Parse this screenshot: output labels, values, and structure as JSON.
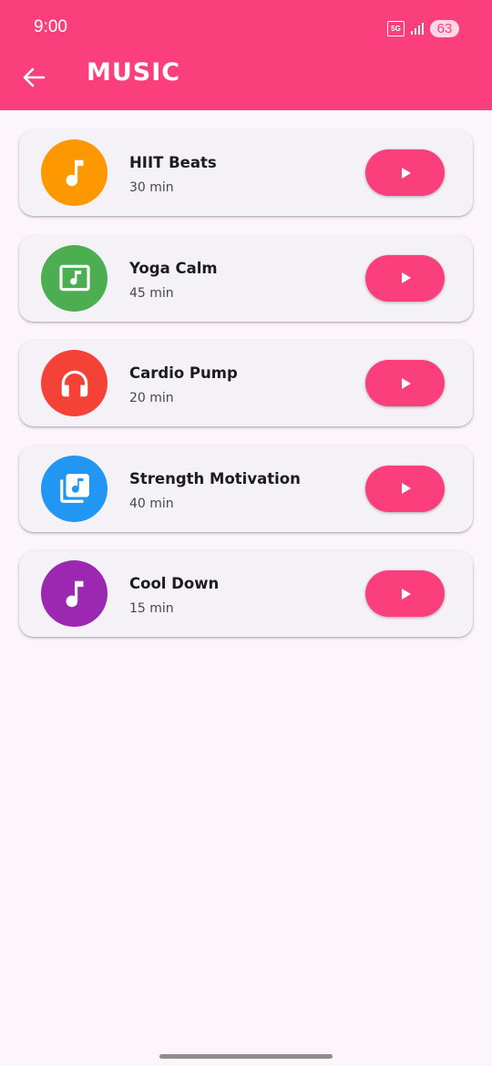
{
  "status": {
    "time": "9:00",
    "network": "5G",
    "battery": "63"
  },
  "header": {
    "title": "MUSIC",
    "back_icon": "arrow-left-icon"
  },
  "tracks": [
    {
      "title": "HIIT Beats",
      "duration": "30 min",
      "color": "#fd9800",
      "icon": "music-note-icon"
    },
    {
      "title": "Yoga Calm",
      "duration": "45 min",
      "color": "#4cae50",
      "icon": "music-video-icon"
    },
    {
      "title": "Cardio Pump",
      "duration": "20 min",
      "color": "#f44336",
      "icon": "headphones-icon"
    },
    {
      "title": "Strength Motivation",
      "duration": "40 min",
      "color": "#2196f3",
      "icon": "library-music-icon"
    },
    {
      "title": "Cool Down",
      "duration": "15 min",
      "color": "#9c27b0",
      "icon": "music-note-icon"
    }
  ],
  "colors": {
    "accent": "#fa3f7c",
    "background": "#fcf5fc",
    "card": "#f4f1f7"
  }
}
